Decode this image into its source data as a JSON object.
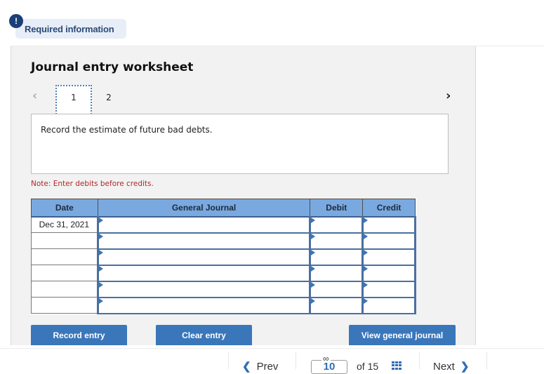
{
  "header": {
    "alert_symbol": "!",
    "required_label": "Required information"
  },
  "worksheet": {
    "title": "Journal entry worksheet",
    "tabs": [
      {
        "label": "1",
        "active": true
      },
      {
        "label": "2",
        "active": false
      }
    ],
    "prev_icon": "‹",
    "next_icon": "›",
    "description": "Record the estimate of future bad debts.",
    "note": "Note: Enter debits before credits."
  },
  "journal": {
    "columns": [
      "Date",
      "General Journal",
      "Debit",
      "Credit"
    ],
    "rows": [
      {
        "date": "Dec 31, 2021",
        "account": "",
        "debit": "",
        "credit": ""
      },
      {
        "date": "",
        "account": "",
        "debit": "",
        "credit": ""
      },
      {
        "date": "",
        "account": "",
        "debit": "",
        "credit": ""
      },
      {
        "date": "",
        "account": "",
        "debit": "",
        "credit": ""
      },
      {
        "date": "",
        "account": "",
        "debit": "",
        "credit": ""
      },
      {
        "date": "",
        "account": "",
        "debit": "",
        "credit": ""
      }
    ]
  },
  "buttons": {
    "record": "Record entry",
    "clear": "Clear entry",
    "view_journal": "View general journal"
  },
  "navigation": {
    "prev_label": "Prev",
    "current_page": "10",
    "of_total": "of 15",
    "next_label": "Next",
    "prev_icon": "chevron-left",
    "next_icon": "chevron-right",
    "link_icon": "link",
    "grid_icon": "grid"
  },
  "colors": {
    "accent": "#3a76ba",
    "header_bg": "#7aa9e0",
    "note_red": "#b3262a",
    "badge_bg": "#e8eef7",
    "alert_navy": "#1a3f78"
  }
}
